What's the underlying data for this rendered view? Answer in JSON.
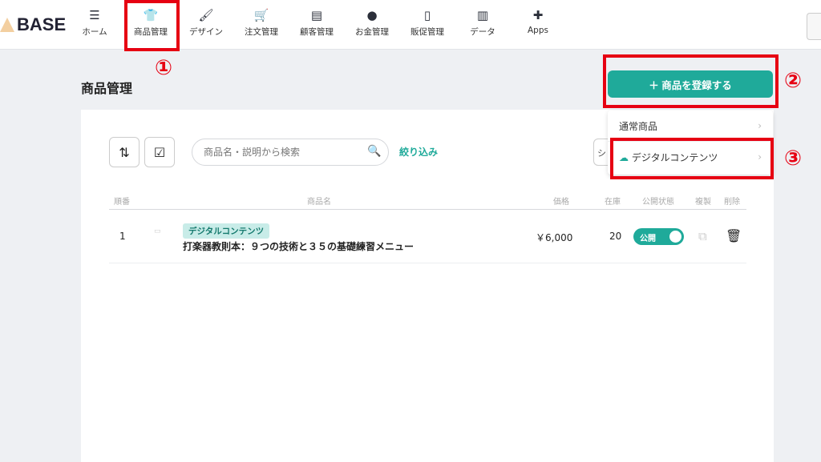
{
  "brand": {
    "name": "BASE"
  },
  "nav": [
    {
      "label": "ホーム",
      "icon": "home-list-icon",
      "glyph": "☰"
    },
    {
      "label": "商品管理",
      "icon": "tshirt-icon",
      "glyph": "👕"
    },
    {
      "label": "デザイン",
      "icon": "brush-icon",
      "glyph": "🖌"
    },
    {
      "label": "注文管理",
      "icon": "cart-icon",
      "glyph": "🛒"
    },
    {
      "label": "顧客管理",
      "icon": "id-card-icon",
      "glyph": "▤"
    },
    {
      "label": "お金管理",
      "icon": "purse-icon",
      "glyph": "●"
    },
    {
      "label": "販促管理",
      "icon": "smartphone-icon",
      "glyph": "▯"
    },
    {
      "label": "データ",
      "icon": "bar-chart-icon",
      "glyph": "▥"
    },
    {
      "label": "Apps",
      "icon": "puzzle-icon",
      "glyph": "✚"
    }
  ],
  "annotations": [
    "①",
    "②",
    "③"
  ],
  "page": {
    "title": "商品管理"
  },
  "add_button": {
    "label": "＋ 商品を登録する"
  },
  "dropdown": {
    "items": [
      {
        "label": "通常商品"
      },
      {
        "label": "デジタルコンテンツ"
      }
    ]
  },
  "toolbar": {
    "search_placeholder": "商品名・説明から検索",
    "filter_label": "絞り込み",
    "hidden_button_label": "シ"
  },
  "table": {
    "headers": [
      "順番",
      "商品名",
      "価格",
      "在庫",
      "公開状態",
      "複製",
      "削除"
    ],
    "rows": [
      {
        "order": "1",
        "badge": "デジタルコンテンツ",
        "name": "打楽器教則本：９つの技術と３５の基礎練習メニュー",
        "price": "￥6,000",
        "stock": "20",
        "status": "公開",
        "published": true
      }
    ]
  },
  "colors": {
    "accent": "#1faa9a",
    "annotation": "#e60012"
  }
}
